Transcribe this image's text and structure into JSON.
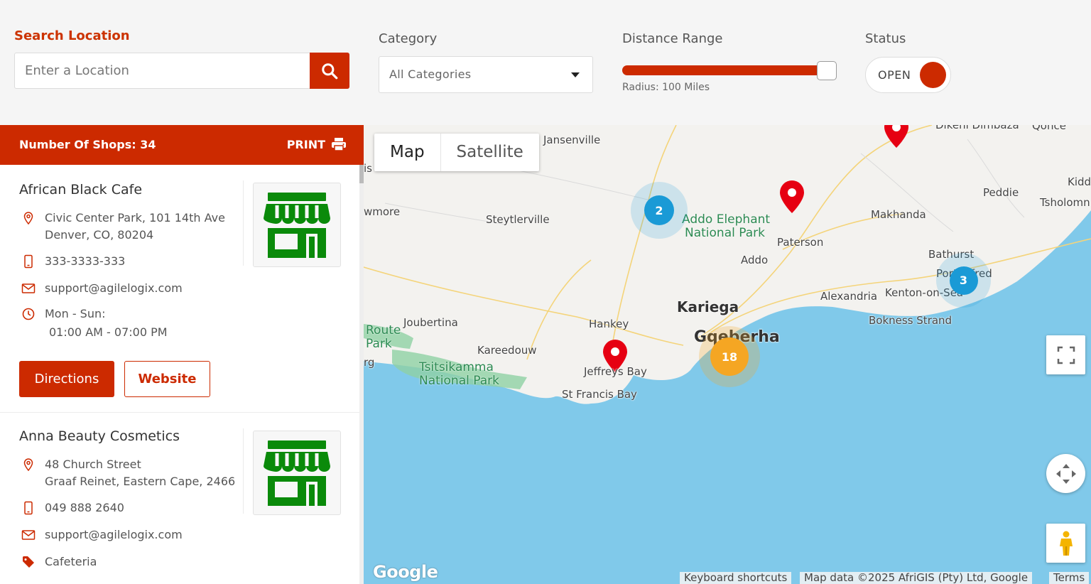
{
  "filters": {
    "search_label": "Search Location",
    "search_placeholder": "Enter a Location",
    "category_label": "Category",
    "category_value": "All Categories",
    "distance_label": "Distance Range",
    "distance_value": 100,
    "radius_text": "Radius: 100  Miles",
    "status_label": "Status",
    "status_value": "OPEN"
  },
  "panel": {
    "count_text": "Number Of Shops: 34",
    "print_label": "PRINT",
    "shops": [
      {
        "name": "African Black Cafe",
        "address_line1": "Civic Center Park, 101 14th Ave",
        "address_line2": "Denver, CO, 80204",
        "phone": "333-3333-333",
        "email": "support@agilelogix.com",
        "hours_label": "Mon - Sun:",
        "hours_value": "01:00 AM - 07:00 PM",
        "directions_label": "Directions",
        "website_label": "Website"
      },
      {
        "name": "Anna Beauty Cosmetics",
        "address_line1": "48 Church Street",
        "address_line2": "Graaf Reinet, Eastern Cape, 2466",
        "phone": "049 888 2640",
        "email": "support@agilelogix.com",
        "category": "Cafeteria"
      }
    ]
  },
  "map": {
    "type_map": "Map",
    "type_satellite": "Satellite",
    "places": [
      "Jansenville",
      "Steytlerville",
      "Addo Elephant",
      "National Park",
      "Paterson",
      "Addo",
      "Makhanda",
      "Peddie",
      "Tsholomn",
      "Kidd",
      "Bathurst",
      "Port Alfred",
      "Alexandria",
      "Kenton-on-Sea",
      "Bokness Strand",
      "Kariega",
      "Gqeberha",
      "Hankey",
      "Joubertina",
      "Kareedouw",
      "Tsitsikamma",
      "National Park",
      "Jeffreys Bay",
      "St Francis Bay",
      "Route",
      "Park",
      "wmore",
      "is",
      "rg",
      "Dikeni Dimbaza",
      "Qonce"
    ],
    "clusters": [
      {
        "count": "2",
        "color": "#1a9ad6"
      },
      {
        "count": "3",
        "color": "#1a9ad6"
      },
      {
        "count": "18",
        "color": "#f5a623"
      }
    ],
    "google_logo": "Google",
    "keyboard_shortcuts": "Keyboard shortcuts",
    "map_data": "Map data ©2025 AfriGIS (Pty) Ltd, Google",
    "terms": "Terms"
  },
  "colors": {
    "accent": "#cc2a00",
    "shop_icon": "#0a8a0a",
    "sea": "#80c9ea",
    "land": "#f3f2ef"
  }
}
